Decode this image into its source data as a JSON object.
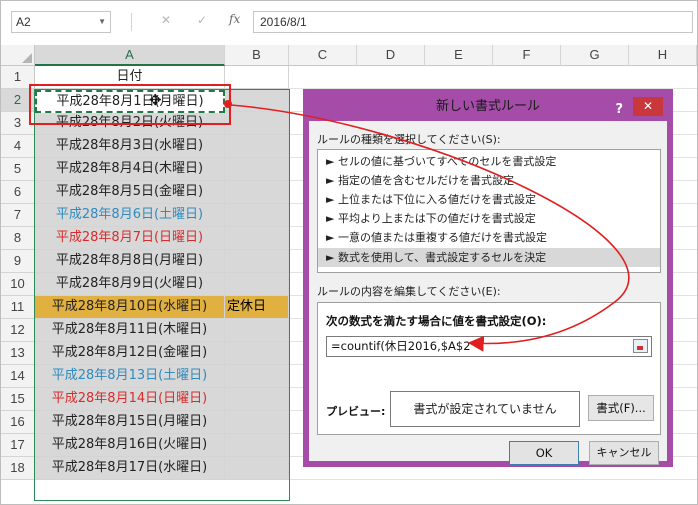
{
  "formula_bar": {
    "name_box": "A2",
    "cancel_glyph": "✕",
    "enter_glyph": "✓",
    "fx_label": "fx",
    "formula": "2016/8/1"
  },
  "columns": [
    "A",
    "B",
    "C",
    "D",
    "E",
    "F",
    "G",
    "H"
  ],
  "rows": [
    {
      "num": "1",
      "a": "日付",
      "b": "",
      "style": "header"
    },
    {
      "num": "2",
      "a": "平成28年8月1日(月曜日)",
      "b": "",
      "style": "selected"
    },
    {
      "num": "3",
      "a": "平成28年8月2日(火曜日)",
      "b": "",
      "style": "normal"
    },
    {
      "num": "4",
      "a": "平成28年8月3日(水曜日)",
      "b": "",
      "style": "normal"
    },
    {
      "num": "5",
      "a": "平成28年8月4日(木曜日)",
      "b": "",
      "style": "normal"
    },
    {
      "num": "6",
      "a": "平成28年8月5日(金曜日)",
      "b": "",
      "style": "normal"
    },
    {
      "num": "7",
      "a": "平成28年8月6日(土曜日)",
      "b": "",
      "style": "saturday"
    },
    {
      "num": "8",
      "a": "平成28年8月7日(日曜日)",
      "b": "",
      "style": "sunday"
    },
    {
      "num": "9",
      "a": "平成28年8月8日(月曜日)",
      "b": "",
      "style": "normal"
    },
    {
      "num": "10",
      "a": "平成28年8月9日(火曜日)",
      "b": "",
      "style": "normal"
    },
    {
      "num": "11",
      "a": "平成28年8月10日(水曜日)",
      "b": "定休日",
      "style": "holiday"
    },
    {
      "num": "12",
      "a": "平成28年8月11日(木曜日)",
      "b": "",
      "style": "normal"
    },
    {
      "num": "13",
      "a": "平成28年8月12日(金曜日)",
      "b": "",
      "style": "normal"
    },
    {
      "num": "14",
      "a": "平成28年8月13日(土曜日)",
      "b": "",
      "style": "saturday"
    },
    {
      "num": "15",
      "a": "平成28年8月14日(日曜日)",
      "b": "",
      "style": "sunday"
    },
    {
      "num": "16",
      "a": "平成28年8月15日(月曜日)",
      "b": "",
      "style": "normal"
    },
    {
      "num": "17",
      "a": "平成28年8月16日(火曜日)",
      "b": "",
      "style": "normal"
    },
    {
      "num": "18",
      "a": "平成28年8月17日(水曜日)",
      "b": "",
      "style": "normal"
    }
  ],
  "dialog": {
    "title": "新しい書式ルール",
    "help": "?",
    "close": "✕",
    "select_rule_label": "ルールの種類を選択してください(S):",
    "rule_types": [
      "► セルの値に基づいてすべてのセルを書式設定",
      "► 指定の値を含むセルだけを書式設定",
      "► 上位または下位に入る値だけを書式設定",
      "► 平均より上または下の値だけを書式設定",
      "► 一意の値または重複する値だけを書式設定",
      "► 数式を使用して、書式設定するセルを決定"
    ],
    "selected_rule_index": 5,
    "edit_label": "ルールの内容を編集してください(E):",
    "formula_caption": "次の数式を満たす場合に値を書式設定(O):",
    "formula_value": "=countif(休日2016,$A$2",
    "preview_label": "プレビュー:",
    "preview_text": "書式が設定されていません",
    "format_button": "書式(F)...",
    "ok_button": "OK",
    "cancel_button": "キャンセル"
  },
  "colors": {
    "accent": "#a44ca8",
    "saturday": "#2e8bc0",
    "sunday": "#d92b2b",
    "holiday_fill": "#e0b040",
    "annotation": "#e02020"
  }
}
